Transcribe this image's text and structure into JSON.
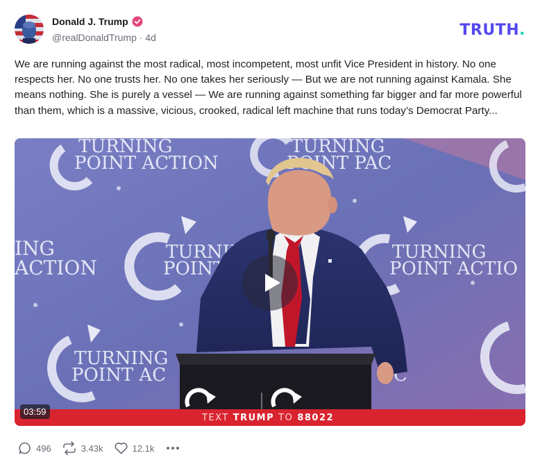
{
  "author": {
    "display_name": "Donald J. Trump",
    "handle_line": "@realDonaldTrump · 4d",
    "verified_icon": "verified-badge-icon",
    "avatar": "profile-avatar"
  },
  "brand": {
    "logo_text": "TRUTH",
    "logo_dot": ".",
    "colors": {
      "primary": "#5448ee",
      "accent": "#17d3b6"
    }
  },
  "post": {
    "text": "We are running against the most radical, most incompetent, most unfit Vice President in history. No one respects her. No one trusts her. No one takes her seriously — But we are not running against Kamala. She means nothing. She is purely a vessel — We are running against something far bigger and far more powerful than them, which is a massive, vicious, crooked, radical left machine that runs today’s Democrat Party..."
  },
  "video": {
    "duration": "03:59",
    "play_icon": "play-icon",
    "backdrop_text": {
      "turning": "TURNING",
      "point_action": "POINT ACTION",
      "point_pac": "POINT PAC",
      "ing": "ING",
      "action": "ACTION",
      "turnin": "TURNIN",
      "point": "POINT",
      "point_actio": "POINT ACTIO",
      "point_ac": "POINT AC",
      "c": "C"
    },
    "banner": {
      "prefix": "TEXT",
      "keyword": "TRUMP",
      "middle": "TO",
      "number": "88022"
    },
    "colors": {
      "banner": "#d92430",
      "backdrop": "#6d74b8"
    }
  },
  "actions": {
    "replies": "496",
    "retruths": "3.43k",
    "likes": "12.1k",
    "reply_icon": "reply-icon",
    "retruth_icon": "retruth-icon",
    "like_icon": "heart-icon",
    "more_icon": "more-icon"
  }
}
